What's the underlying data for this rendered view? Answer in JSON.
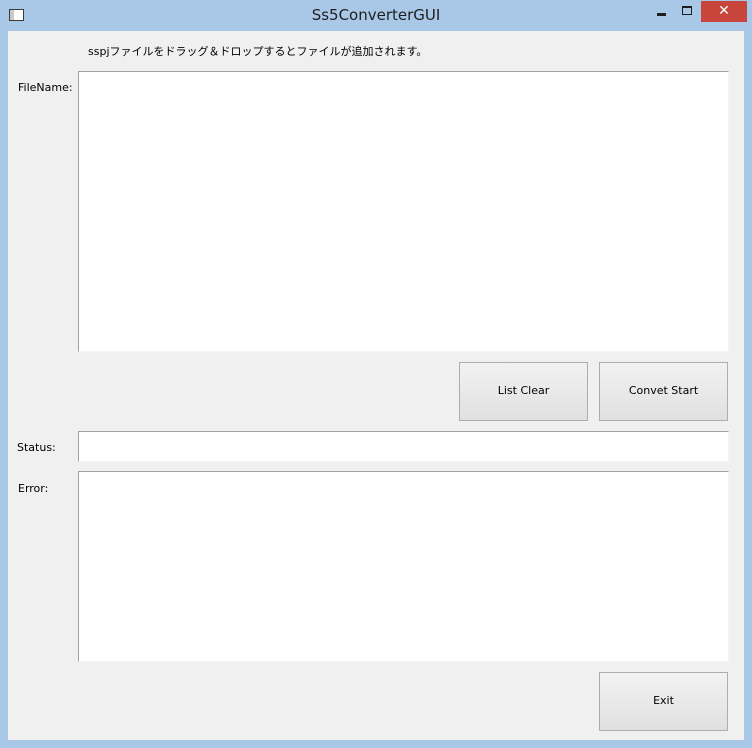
{
  "window": {
    "title": "Ss5ConverterGUI",
    "close_glyph": "✕",
    "accent_color": "#a9c8e8",
    "close_color": "#c7453b"
  },
  "main": {
    "hint": "sspjファイルをドラッグ＆ドロップするとファイルが追加されます。",
    "filename_label": "FileName:",
    "status_label": "Status:",
    "error_label": "Error:",
    "status_value": "",
    "error_value": ""
  },
  "buttons": {
    "list_clear": "List Clear",
    "convert_start": "Convet Start",
    "exit": "Exit"
  },
  "icons": {
    "app": "app-window-icon",
    "minimize": "minimize-icon",
    "maximize": "maximize-icon",
    "close": "close-icon"
  }
}
